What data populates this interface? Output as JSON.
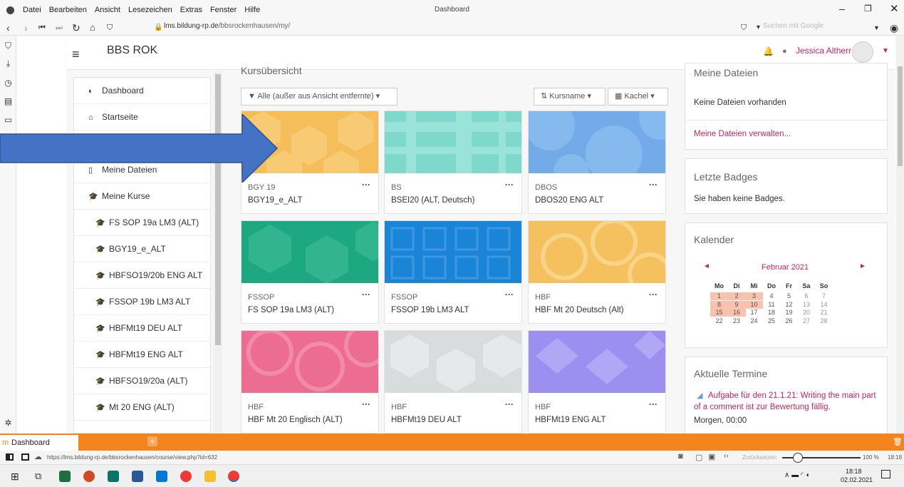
{
  "window": {
    "title": "Dashboard"
  },
  "menu": [
    "Datei",
    "Bearbeiten",
    "Ansicht",
    "Lesezeichen",
    "Extras",
    "Fenster",
    "Hilfe"
  ],
  "address": {
    "domain": "lms.bildung-rp.de",
    "path": "/bbsrockenhausen/my/"
  },
  "search": {
    "placeholder": "Suchen mit Google"
  },
  "site": {
    "name": "BBS ROK"
  },
  "user": {
    "name": "Jessica Altherr"
  },
  "nav": {
    "items": [
      {
        "label": "Dashboard",
        "icon": "dashboard-icon"
      },
      {
        "label": "Startseite",
        "icon": "home-icon"
      },
      {
        "label": "Meine Dateien",
        "icon": "file-icon"
      },
      {
        "label": "Meine Kurse",
        "icon": "graduation-cap-icon"
      },
      {
        "label": "FS SOP 19a LM3 (ALT)",
        "icon": "graduation-cap-icon"
      },
      {
        "label": "BGY19_e_ALT",
        "icon": "graduation-cap-icon"
      },
      {
        "label": "HBFSO19/20b ENG ALT",
        "icon": "graduation-cap-icon"
      },
      {
        "label": "FSSOP 19b LM3 ALT",
        "icon": "graduation-cap-icon"
      },
      {
        "label": "HBFMt19 DEU ALT",
        "icon": "graduation-cap-icon"
      },
      {
        "label": "HBFMt19 ENG ALT",
        "icon": "graduation-cap-icon"
      },
      {
        "label": "HBFSO19/20a (ALT)",
        "icon": "graduation-cap-icon"
      },
      {
        "label": "Mt 20 ENG (ALT)",
        "icon": "graduation-cap-icon"
      }
    ]
  },
  "overview": {
    "title": "Kursübersicht",
    "filter_label": "Alle (außer aus Ansicht entfernte)",
    "sort_label": "Kursname",
    "view_label": "Kachel"
  },
  "courses": [
    {
      "category": "BGY 19",
      "name": "BGY19_e_ALT",
      "color": "#f5be5b"
    },
    {
      "category": "BS",
      "name": "BSEI20 (ALT, Deutsch)",
      "color": "#7fd8cc"
    },
    {
      "category": "DBOS",
      "name": "DBOS20 ENG ALT",
      "color": "#72abe8"
    },
    {
      "category": "FSSOP",
      "name": "FS SOP 19a LM3 (ALT)",
      "color": "#1ea882"
    },
    {
      "category": "FSSOP",
      "name": "FSSOP 19b LM3 ALT",
      "color": "#1a84d6"
    },
    {
      "category": "HBF",
      "name": "HBF Mt 20 Deutsch (Alt)",
      "color": "#f5c15f"
    },
    {
      "category": "HBF",
      "name": "HBF Mt 20 Englisch (ALT)",
      "color": "#ec6c92"
    },
    {
      "category": "HBF",
      "name": "HBFMt19 DEU ALT",
      "color": "#d9dcdd"
    },
    {
      "category": "HBF",
      "name": "HBFMt19 ENG ALT",
      "color": "#9d8ff0"
    }
  ],
  "blocks": {
    "files": {
      "title": "Meine Dateien",
      "empty": "Keine Dateien vorhanden",
      "manage": "Meine Dateien verwalten..."
    },
    "badges": {
      "title": "Letzte Badges",
      "empty": "Sie haben keine Badges."
    },
    "calendar": {
      "title": "Kalender",
      "month": "Februar 2021",
      "weekdays": [
        "Mo",
        "Di",
        "Mi",
        "Do",
        "Fr",
        "Sa",
        "So"
      ],
      "weeks": [
        [
          "1",
          "2",
          "3",
          "4",
          "5",
          "6",
          "7"
        ],
        [
          "8",
          "9",
          "10",
          "11",
          "12",
          "13",
          "14"
        ],
        [
          "15",
          "16",
          "17",
          "18",
          "19",
          "20",
          "21"
        ],
        [
          "22",
          "23",
          "24",
          "25",
          "26",
          "27",
          "28"
        ]
      ],
      "highlight_color": "#f8c2ae"
    },
    "events": {
      "title": "Aktuelle Termine",
      "event": "Aufgabe für den 21.1.21: Writing the main part of a comment ist zur Bewertung fällig.",
      "time": "Morgen, 00:00"
    }
  },
  "tab": {
    "label": "Dashboard"
  },
  "status": {
    "url": "https://lms.bildung-rp.de/bbsrockenhausen/course/view.php?id=632",
    "reset": "Zurücksetzen",
    "zoom": "100 %",
    "time": "18:18"
  },
  "taskbar": {
    "time": "18:18",
    "date": "02.02.2021"
  },
  "colors": {
    "accent": "#c1255d",
    "tabbar": "#f4841e",
    "arrow": "#4472c4"
  }
}
